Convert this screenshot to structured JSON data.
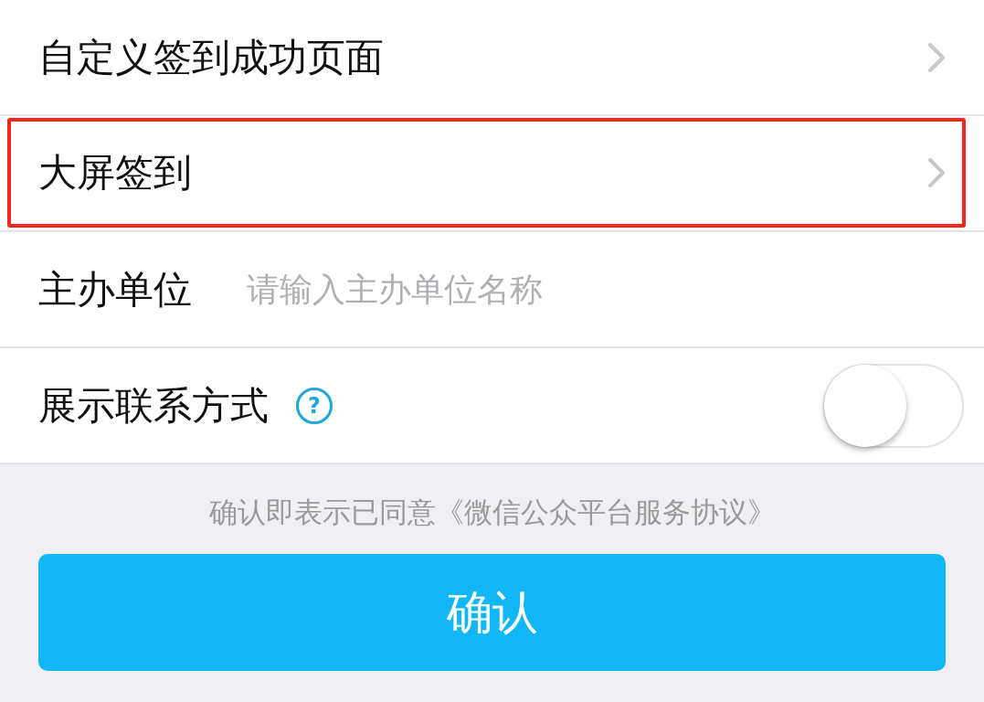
{
  "settings": [
    {
      "kind": "link",
      "label": "自定义签到成功页面",
      "highlighted": false
    },
    {
      "kind": "link",
      "label": "大屏签到",
      "highlighted": true
    },
    {
      "kind": "input",
      "label": "主办单位",
      "placeholder": "请输入主办单位名称",
      "highlighted": false
    },
    {
      "kind": "toggle",
      "label": "展示联系方式",
      "help_icon": "?",
      "on": false,
      "highlighted": false
    }
  ],
  "agreement": "确认即表示已同意《微信公众平台服务协议》",
  "confirm_button": "确认"
}
